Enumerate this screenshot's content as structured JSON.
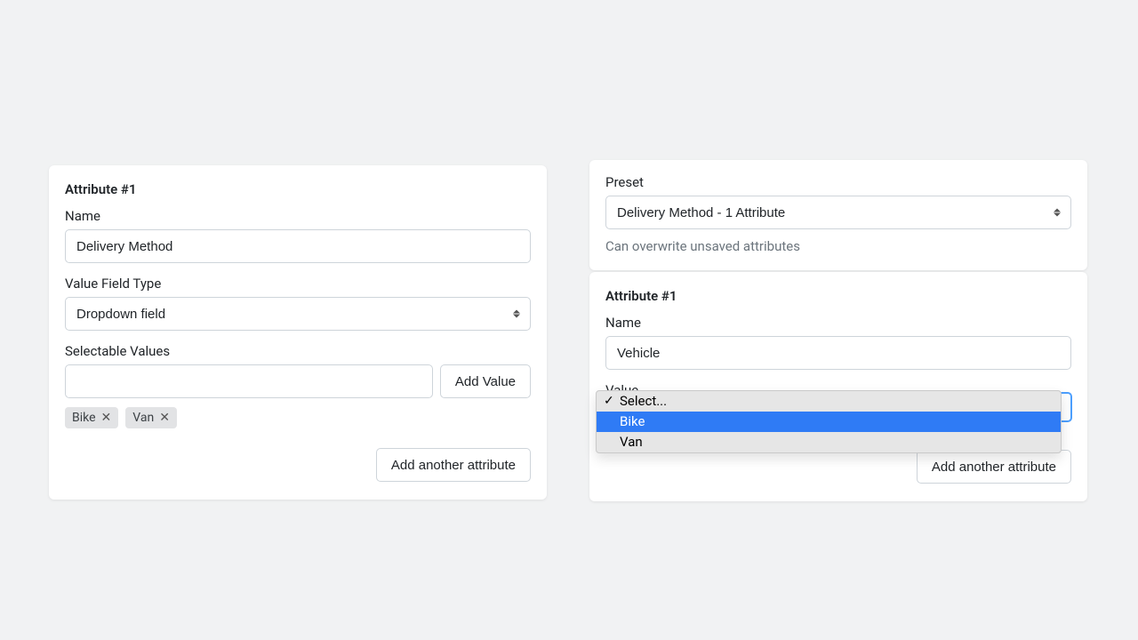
{
  "left": {
    "title": "Attribute #1",
    "name_label": "Name",
    "name_value": "Delivery Method",
    "type_label": "Value Field Type",
    "type_value": "Dropdown field",
    "values_label": "Selectable Values",
    "add_value_label": "Add Value",
    "chips": [
      {
        "label": "Bike"
      },
      {
        "label": "Van"
      }
    ],
    "add_another_label": "Add another attribute"
  },
  "preset": {
    "label": "Preset",
    "value": "Delivery Method - 1 Attribute",
    "helper": "Can overwrite unsaved attributes"
  },
  "right": {
    "title": "Attribute #1",
    "name_label": "Name",
    "name_value": "Vehicle",
    "value_label": "Value",
    "dropdown": {
      "selected": "Select...",
      "options": [
        {
          "label": "Select...",
          "checked": true,
          "highlight": false
        },
        {
          "label": "Bike",
          "checked": false,
          "highlight": true
        },
        {
          "label": "Van",
          "checked": false,
          "highlight": false
        }
      ]
    },
    "add_another_label": "Add another attribute"
  }
}
